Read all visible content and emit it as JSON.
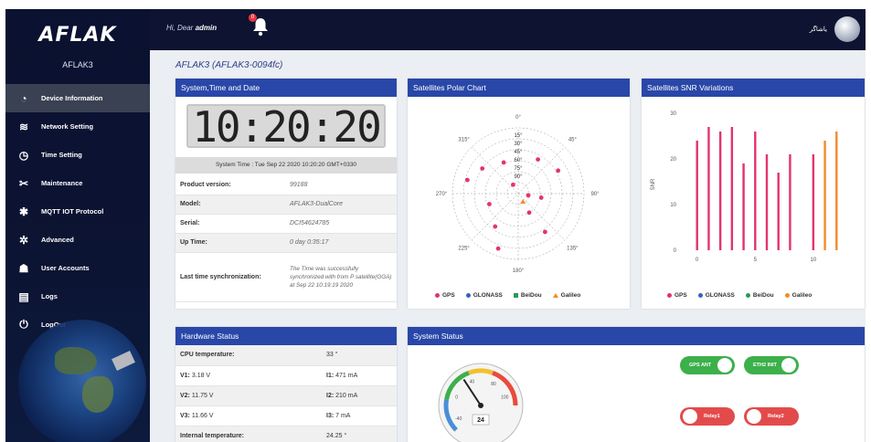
{
  "app": {
    "logo": "AFLAK",
    "device_name": "AFLAK3"
  },
  "topbar": {
    "greeting": "Hi, Dear ",
    "username": "admin",
    "notifications_count": "0",
    "user_display": "یاشاگر"
  },
  "sidebar": {
    "items": [
      {
        "label": "Device Information",
        "icon": "gauge-icon",
        "active": true
      },
      {
        "label": "Network Setting",
        "icon": "wifi-icon"
      },
      {
        "label": "Time Setting",
        "icon": "clock-icon"
      },
      {
        "label": "Maintenance",
        "icon": "tools-icon"
      },
      {
        "label": "MQTT IOT Protocol",
        "icon": "gear-icon"
      },
      {
        "label": "Advanced",
        "icon": "cog-icon"
      },
      {
        "label": "User Accounts",
        "icon": "users-icon"
      },
      {
        "label": "Logs",
        "icon": "file-icon"
      },
      {
        "label": "LogOut",
        "icon": "power-icon"
      }
    ]
  },
  "page_title": "AFLAK3 (AFLAK3-0094fc)",
  "system_card": {
    "title": "System,Time and Date",
    "clock": "10:20:20",
    "system_time": "System Time : Tue Sep 22 2020 10:20:20 GMT+0330",
    "rows": [
      {
        "key": "Product version:",
        "value": "99188"
      },
      {
        "key": "Model:",
        "value": "AFLAK3-DualCore"
      },
      {
        "key": "Serial:",
        "value": "DCI54624785"
      },
      {
        "key": "Up Time:",
        "value": "0 day 0:35:17"
      },
      {
        "key": "Last time synchronization:",
        "value": "The Time was successfully synchronized with from P satellite(GGA) at Sep 22 10:19:19 2020"
      }
    ]
  },
  "polar_card": {
    "title": "Satellites Polar Chart",
    "angle_labels": [
      "0°",
      "45°",
      "90°",
      "135°",
      "180°",
      "225°",
      "270°",
      "315°"
    ],
    "elevation_labels": [
      "15°",
      "30°",
      "45°",
      "60°",
      "75°",
      "90°"
    ],
    "legend": [
      {
        "name": "GPS",
        "color": "#e2336f"
      },
      {
        "name": "GLONASS",
        "color": "#3a5fc0"
      },
      {
        "name": "BeiDou",
        "color": "#2a9a57"
      },
      {
        "name": "Galileo",
        "color": "#f08c2a"
      }
    ]
  },
  "snr_card": {
    "title": "Satellites SNR Variations",
    "ylabel": "SNR",
    "y_ticks": [
      "0",
      "10",
      "20",
      "30"
    ],
    "x_ticks": [
      "0",
      "5",
      "10"
    ],
    "legend": [
      {
        "name": "GPS",
        "color": "#e2336f"
      },
      {
        "name": "GLONASS",
        "color": "#3a5fc0"
      },
      {
        "name": "BeiDou",
        "color": "#2a9a57"
      },
      {
        "name": "Galileo",
        "color": "#f08c2a"
      }
    ]
  },
  "hardware_card": {
    "title": "Hardware Status",
    "rows": [
      {
        "k1": "CPU temperature:",
        "v1": "",
        "k2": "",
        "v2": "33 °"
      },
      {
        "k1": "V1:",
        "v1": "3.18 V",
        "k2": "I1:",
        "v2": "471 mA"
      },
      {
        "k1": "V2:",
        "v1": "11.75 V",
        "k2": "I2:",
        "v2": "210 mA"
      },
      {
        "k1": "V3:",
        "v1": "11.66 V",
        "k2": "I3:",
        "v2": "7 mA"
      },
      {
        "k1": "Internal temperature:",
        "v1": "",
        "k2": "",
        "v2": "24.25 °"
      }
    ]
  },
  "status_card": {
    "title": "System Status",
    "gauge_value": "24",
    "gauge_ticks": [
      "-40",
      "0",
      "40",
      "80",
      "100"
    ],
    "toggles": [
      {
        "label": "GPS ANT",
        "state": "on"
      },
      {
        "label": "ETH2 INIT",
        "state": "on"
      },
      {
        "label": "Relay1",
        "state": "off"
      },
      {
        "label": "Relay2",
        "state": "off"
      }
    ]
  },
  "chart_data": [
    {
      "type": "scatter",
      "subtype": "polar",
      "title": "Satellites Polar Chart",
      "angle_ticks": [
        0,
        45,
        90,
        135,
        180,
        225,
        270,
        315
      ],
      "radial_ticks": [
        15,
        30,
        45,
        60,
        75,
        90
      ],
      "series": [
        {
          "name": "GPS",
          "points": [
            {
              "az": 305,
              "el": 30
            },
            {
              "az": 335,
              "el": 43
            },
            {
              "az": 30,
              "el": 36
            },
            {
              "az": 60,
              "el": 27
            },
            {
              "az": 100,
              "el": 58
            },
            {
              "az": 285,
              "el": 18
            },
            {
              "az": 250,
              "el": 48
            },
            {
              "az": 215,
              "el": 35
            },
            {
              "az": 200,
              "el": 10
            },
            {
              "az": 145,
              "el": 26
            },
            {
              "az": 150,
              "el": 60
            },
            {
              "az": 100,
              "el": 76
            },
            {
              "az": 330,
              "el": 76
            }
          ]
        },
        {
          "name": "Galileo",
          "points": [
            {
              "az": 150,
              "el": 77
            }
          ]
        }
      ]
    },
    {
      "type": "bar",
      "title": "Satellites SNR Variations",
      "ylabel": "SNR",
      "ylim": [
        0,
        30
      ],
      "xlim": [
        -1,
        13
      ],
      "series": [
        {
          "name": "GPS",
          "x": [
            0,
            1,
            2,
            3,
            4,
            5,
            6,
            7,
            8,
            10
          ],
          "values": [
            24,
            27,
            26,
            27,
            19,
            26,
            21,
            17,
            21,
            21
          ]
        },
        {
          "name": "Galileo",
          "x": [
            11,
            12
          ],
          "values": [
            24,
            26
          ]
        }
      ]
    }
  ]
}
